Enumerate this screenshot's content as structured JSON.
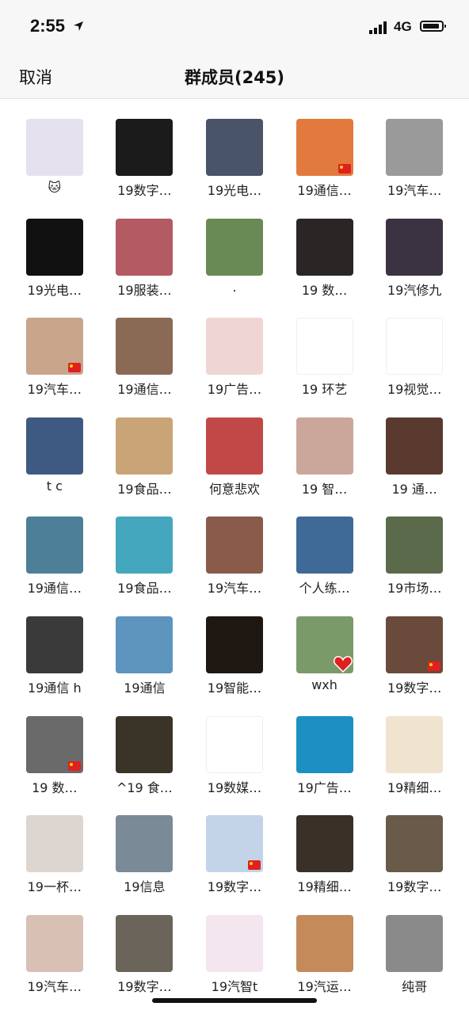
{
  "status_bar": {
    "time": "2:55",
    "network": "4G"
  },
  "nav": {
    "cancel_label": "取消",
    "title": "群成员(245)"
  },
  "members": [
    {
      "name": "🐱",
      "color": "#e6e1ef",
      "badge": ""
    },
    {
      "name": "19数字…",
      "color": "#1b1b1b",
      "badge": ""
    },
    {
      "name": "19光电…",
      "color": "#4a5468",
      "badge": ""
    },
    {
      "name": "19通信…",
      "color": "#e27a3e",
      "badge": "flag"
    },
    {
      "name": "19汽车…",
      "color": "#9a9a9a",
      "badge": ""
    },
    {
      "name": "19光电…",
      "color": "#111111",
      "badge": ""
    },
    {
      "name": "19服装…",
      "color": "#b45a62",
      "badge": ""
    },
    {
      "name": ".",
      "color": "#6a8a55",
      "badge": ""
    },
    {
      "name": "19 数…",
      "color": "#2a2626",
      "badge": ""
    },
    {
      "name": "19汽修九",
      "color": "#3c3342",
      "badge": ""
    },
    {
      "name": "19汽车…",
      "color": "#c9a58c",
      "badge": "flag"
    },
    {
      "name": "19通信…",
      "color": "#8a6a55",
      "badge": ""
    },
    {
      "name": "19广告…",
      "color": "#efd6d4",
      "badge": ""
    },
    {
      "name": "19  环艺",
      "color": "#ffffff",
      "badge": ""
    },
    {
      "name": "19视觉…",
      "color": "#ffffff",
      "badge": ""
    },
    {
      "name": "t c",
      "color": "#3f5a82",
      "badge": ""
    },
    {
      "name": "19食品…",
      "color": "#c9a476",
      "badge": ""
    },
    {
      "name": "何意悲欢",
      "color": "#c24848",
      "badge": ""
    },
    {
      "name": "19 智…",
      "color": "#caa79a",
      "badge": ""
    },
    {
      "name": "19  通…",
      "color": "#5a3a2f",
      "badge": ""
    },
    {
      "name": "19通信…",
      "color": "#4d7f98",
      "badge": ""
    },
    {
      "name": "19食品…",
      "color": "#44a7bd",
      "badge": ""
    },
    {
      "name": "19汽车…",
      "color": "#8a5a4a",
      "badge": ""
    },
    {
      "name": "个人练…",
      "color": "#3f6a98",
      "badge": ""
    },
    {
      "name": "19市场…",
      "color": "#5a6a4a",
      "badge": ""
    },
    {
      "name": "19通信 h",
      "color": "#3a3a3a",
      "badge": ""
    },
    {
      "name": "19通信",
      "color": "#5d95bf",
      "badge": ""
    },
    {
      "name": "19智能…",
      "color": "#1f1712",
      "badge": ""
    },
    {
      "name": "wxh",
      "color": "#7b9a6a",
      "badge": "heart"
    },
    {
      "name": "19数字…",
      "color": "#6a4a3a",
      "badge": "flag"
    },
    {
      "name": "19  数…",
      "color": "#6a6a6a",
      "badge": "flag"
    },
    {
      "name": "^19 食…",
      "color": "#3a3328",
      "badge": ""
    },
    {
      "name": "19数媒…",
      "color": "#ffffff",
      "badge": ""
    },
    {
      "name": "19广告…",
      "color": "#1d8fc2",
      "badge": ""
    },
    {
      "name": "19精细…",
      "color": "#f0e3cf",
      "badge": ""
    },
    {
      "name": "19一杯…",
      "color": "#ddd5d0",
      "badge": ""
    },
    {
      "name": "19信息",
      "color": "#7a8a96",
      "badge": ""
    },
    {
      "name": "19数字…",
      "color": "#c3d4e8",
      "badge": "flag"
    },
    {
      "name": "19精细…",
      "color": "#3a3028",
      "badge": ""
    },
    {
      "name": "19数字…",
      "color": "#6a5a4a",
      "badge": ""
    },
    {
      "name": "19汽车…",
      "color": "#d8c0b4",
      "badge": ""
    },
    {
      "name": "19数字…",
      "color": "#6a645a",
      "badge": ""
    },
    {
      "name": "19汽智t",
      "color": "#f3e6ee",
      "badge": ""
    },
    {
      "name": "19汽运…",
      "color": "#c48a5a",
      "badge": ""
    },
    {
      "name": "纯哥",
      "color": "#8a8a8a",
      "badge": ""
    }
  ]
}
